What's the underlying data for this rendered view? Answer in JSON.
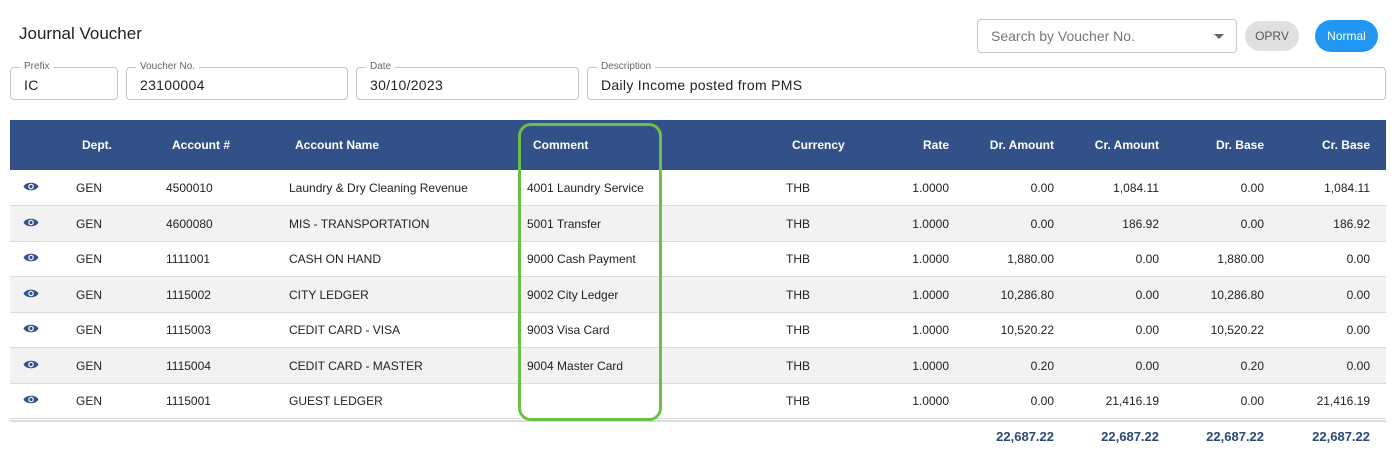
{
  "title": "Journal Voucher",
  "search": {
    "placeholder": "Search by Voucher No."
  },
  "buttons": {
    "oprv": "OPRV",
    "normal": "Normal"
  },
  "fields": {
    "prefix": {
      "label": "Prefix",
      "value": "IC"
    },
    "voucher_no": {
      "label": "Voucher No.",
      "value": "23100004"
    },
    "date": {
      "label": "Date",
      "value": "30/10/2023"
    },
    "description": {
      "label": "Description",
      "value": "Daily Income posted from PMS"
    }
  },
  "table": {
    "columns": [
      "Dept.",
      "Account #",
      "Account Name",
      "Comment",
      "Currency",
      "Rate",
      "Dr. Amount",
      "Cr. Amount",
      "Dr. Base",
      "Cr. Base"
    ],
    "rows": [
      [
        "GEN",
        "4500010",
        "Laundry & Dry Cleaning Revenue",
        "4001 Laundry Service",
        "THB",
        "1.0000",
        "0.00",
        "1,084.11",
        "0.00",
        "1,084.11"
      ],
      [
        "GEN",
        "4600080",
        "MIS - TRANSPORTATION",
        "5001 Transfer",
        "THB",
        "1.0000",
        "0.00",
        "186.92",
        "0.00",
        "186.92"
      ],
      [
        "GEN",
        "1111001",
        "CASH ON HAND",
        "9000 Cash Payment",
        "THB",
        "1.0000",
        "1,880.00",
        "0.00",
        "1,880.00",
        "0.00"
      ],
      [
        "GEN",
        "1115002",
        "CITY LEDGER",
        "9002 City Ledger",
        "THB",
        "1.0000",
        "10,286.80",
        "0.00",
        "10,286.80",
        "0.00"
      ],
      [
        "GEN",
        "1115003",
        "CEDIT CARD - VISA",
        "9003 Visa Card",
        "THB",
        "1.0000",
        "10,520.22",
        "0.00",
        "10,520.22",
        "0.00"
      ],
      [
        "GEN",
        "1115004",
        "CEDIT CARD - MASTER",
        "9004 Master Card",
        "THB",
        "1.0000",
        "0.20",
        "0.00",
        "0.20",
        "0.00"
      ],
      [
        "GEN",
        "1115001",
        "GUEST LEDGER",
        "",
        "THB",
        "1.0000",
        "0.00",
        "21,416.19",
        "0.00",
        "21,416.19"
      ]
    ],
    "totals": {
      "dr_amount": "22,687.22",
      "cr_amount": "22,687.22",
      "dr_base": "22,687.22",
      "cr_base": "22,687.22"
    }
  },
  "colors": {
    "header": "#325188",
    "accent": "#2196f3",
    "highlight": "#6cc04a",
    "totals": "#2b4a78"
  },
  "icons": {
    "row_view": "eye-icon",
    "search_dropdown": "chevron-down-icon"
  }
}
